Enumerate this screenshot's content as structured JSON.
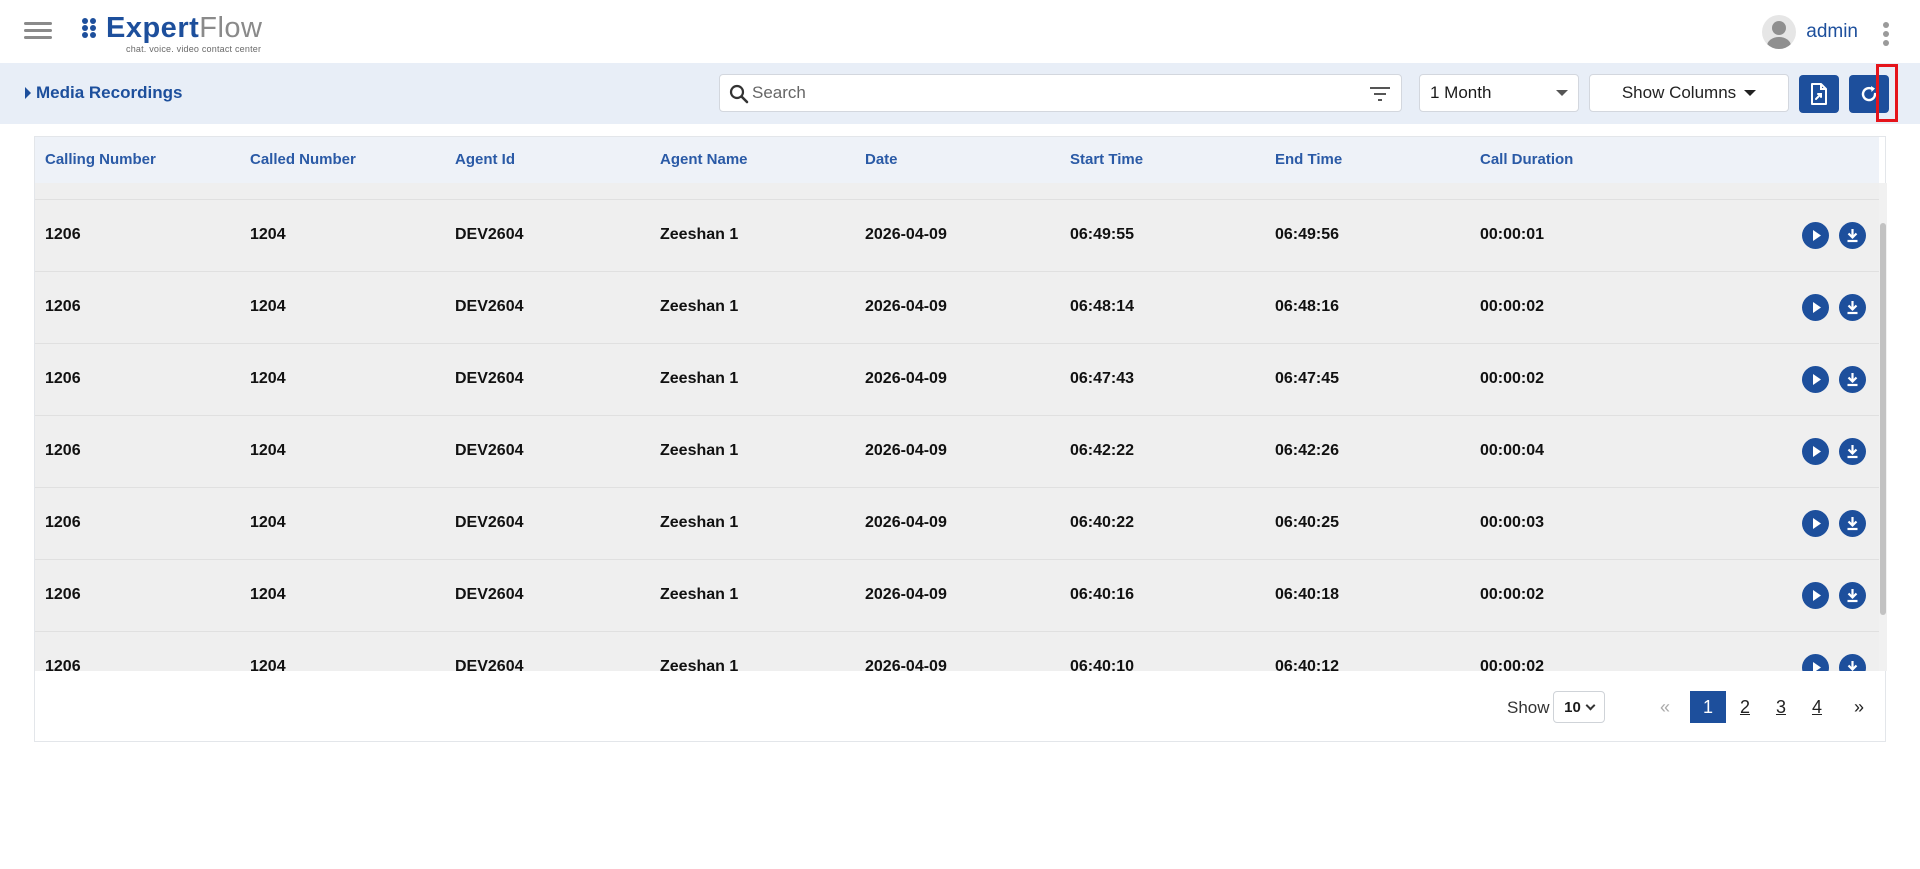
{
  "header": {
    "logo_main": "Expert",
    "logo_accent": "Flow",
    "logo_tagline": "chat. voice. video contact center",
    "username": "admin"
  },
  "toolbar": {
    "page_title": "Media Recordings",
    "search_placeholder": "Search",
    "range_value": "1 Month",
    "columns_label": "Show Columns"
  },
  "table": {
    "columns": [
      "Calling Number",
      "Called Number",
      "Agent Id",
      "Agent Name",
      "Date",
      "Start Time",
      "End Time",
      "Call Duration"
    ],
    "rows": [
      [
        "1206",
        "1204",
        "DEV2604",
        "Zeeshan 1",
        "2026-04-09",
        "06:49:55",
        "06:49:56",
        "00:00:01"
      ],
      [
        "1206",
        "1204",
        "DEV2604",
        "Zeeshan 1",
        "2026-04-09",
        "06:48:14",
        "06:48:16",
        "00:00:02"
      ],
      [
        "1206",
        "1204",
        "DEV2604",
        "Zeeshan 1",
        "2026-04-09",
        "06:47:43",
        "06:47:45",
        "00:00:02"
      ],
      [
        "1206",
        "1204",
        "DEV2604",
        "Zeeshan 1",
        "2026-04-09",
        "06:42:22",
        "06:42:26",
        "00:00:04"
      ],
      [
        "1206",
        "1204",
        "DEV2604",
        "Zeeshan 1",
        "2026-04-09",
        "06:40:22",
        "06:40:25",
        "00:00:03"
      ],
      [
        "1206",
        "1204",
        "DEV2604",
        "Zeeshan 1",
        "2026-04-09",
        "06:40:16",
        "06:40:18",
        "00:00:02"
      ],
      [
        "1206",
        "1204",
        "DEV2604",
        "Zeeshan 1",
        "2026-04-09",
        "06:40:10",
        "06:40:12",
        "00:00:02"
      ]
    ]
  },
  "pagination": {
    "show_label": "Show",
    "page_size": "10",
    "prev": "«",
    "next": "»",
    "pages": [
      "1",
      "2",
      "3",
      "4"
    ],
    "current_page": "1"
  },
  "colors": {
    "brand": "#1d4f9c",
    "toolbar_bg": "#e8eef7",
    "row_bg": "#efefef",
    "highlight": "#e5141b"
  },
  "icons": {
    "menu": "hamburger-icon",
    "search": "search-icon",
    "filter": "filter-icon",
    "export": "file-export-icon",
    "refresh": "refresh-icon",
    "play": "play-icon",
    "download": "download-icon",
    "more": "kebab-menu-icon"
  }
}
